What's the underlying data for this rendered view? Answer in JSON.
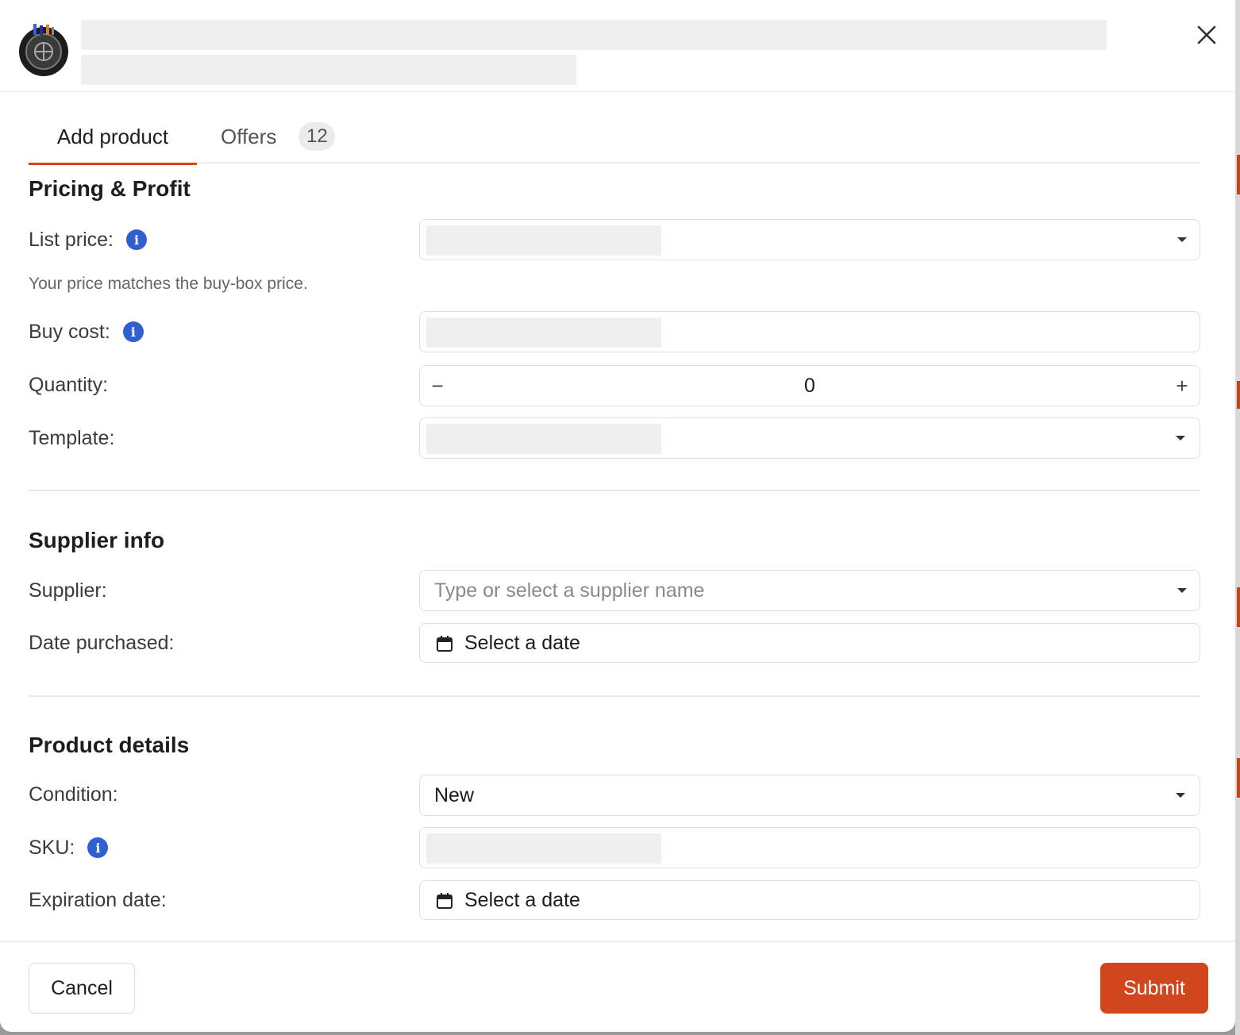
{
  "tabs": {
    "add_product": "Add product",
    "offers": "Offers",
    "offers_count": "12"
  },
  "pricing": {
    "title": "Pricing & Profit",
    "list_price_label": "List price:",
    "helper_text": "Your price matches the buy-box price.",
    "buy_cost_label": "Buy cost:",
    "quantity_label": "Quantity:",
    "quantity_value": "0",
    "minus": "−",
    "plus": "+",
    "template_label": "Template:"
  },
  "supplier": {
    "title": "Supplier info",
    "supplier_label": "Supplier:",
    "supplier_placeholder": "Type or select a supplier name",
    "date_label": "Date purchased:",
    "date_placeholder": "Select a date"
  },
  "details": {
    "title": "Product details",
    "condition_label": "Condition:",
    "condition_value": "New",
    "sku_label": "SKU:",
    "expiration_label": "Expiration date:",
    "expiration_placeholder": "Select a date"
  },
  "footer": {
    "cancel": "Cancel",
    "submit": "Submit"
  },
  "icons": {
    "info": "info-icon",
    "close": "close-icon",
    "calendar": "calendar-icon",
    "dropdown": "chevron-down-icon"
  },
  "colors": {
    "accent": "#d2461d",
    "info": "#2f5fd0"
  }
}
